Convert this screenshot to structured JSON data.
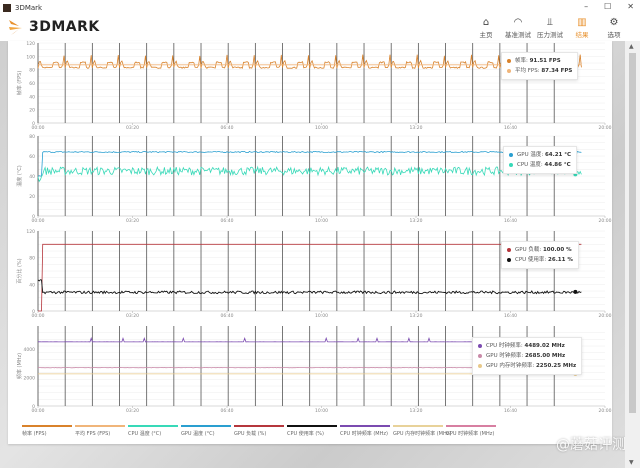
{
  "window": {
    "title": "3DMark",
    "minimize": "–",
    "maximize": "☐",
    "close": "✕"
  },
  "header": {
    "logo": "3DMARK",
    "nav": [
      {
        "label": "主页",
        "icon": "home-icon",
        "glyph": "⌂"
      },
      {
        "label": "基准测试",
        "icon": "gauge-icon",
        "glyph": "◠"
      },
      {
        "label": "压力测试",
        "icon": "stress-chart-icon",
        "glyph": "⫫"
      },
      {
        "label": "结果",
        "icon": "results-bar-icon",
        "glyph": "▥",
        "active": true
      },
      {
        "label": "选项",
        "icon": "gear-icon",
        "glyph": "⚙"
      }
    ]
  },
  "tooltips": {
    "fps": [
      {
        "label": "帧率:",
        "value": "91.51 FPS",
        "color": "#d9822b"
      },
      {
        "label": "平均 FPS:",
        "value": "87.34 FPS",
        "color": "#f0b57a"
      }
    ],
    "temp": [
      {
        "label": "GPU 温度:",
        "value": "64.21 °C",
        "color": "#2a9fd0"
      },
      {
        "label": "CPU 温度:",
        "value": "44.86 °C",
        "color": "#38d9b8"
      }
    ],
    "load": [
      {
        "label": "GPU 负载:",
        "value": "100.00 %",
        "color": "#b5363c"
      },
      {
        "label": "CPU 使用率:",
        "value": "26.11 %",
        "color": "#111111"
      }
    ],
    "clock": [
      {
        "label": "CPU 时钟频率:",
        "value": "4489.02 MHz",
        "color": "#7b4bb0"
      },
      {
        "label": "GPU 时钟频率:",
        "value": "2685.00 MHz",
        "color": "#c98aa8"
      },
      {
        "label": "GPU 内存时钟频率:",
        "value": "2250.25 MHz",
        "color": "#e8c98a"
      }
    ]
  },
  "legend": [
    {
      "label": "帧率 (FPS)",
      "color": "#d9822b"
    },
    {
      "label": "平均 FPS (FPS)",
      "color": "#f0b57a"
    },
    {
      "label": "CPU 温度 (°C)",
      "color": "#38d9b8"
    },
    {
      "label": "GPU 温度 (°C)",
      "color": "#2a9fd0"
    },
    {
      "label": "GPU 负载 (%)",
      "color": "#b5363c"
    },
    {
      "label": "CPU 使用率 (%)",
      "color": "#111111"
    },
    {
      "label": "CPU 时钟频率 (MHz)",
      "color": "#7b4bb0"
    },
    {
      "label": "GPU 内存时钟频率 (MHz)",
      "color": "#e8d29a"
    },
    {
      "label": "GPU 时钟频率 (MHz)",
      "color": "#d77fa1"
    }
  ],
  "watermark": "@蘑菇评测",
  "chart_data": [
    {
      "type": "line",
      "ylabel": "帧率 (FPS)",
      "ylim": [
        0,
        120
      ],
      "yticks": [
        0,
        20,
        40,
        60,
        80,
        100,
        120
      ],
      "xticks": [
        "00:00",
        "03:20",
        "06:40",
        "10:00",
        "13:20",
        "16:40",
        "20:00"
      ],
      "xlim_sec": [
        0,
        1200
      ],
      "end_sec": 1150,
      "series": [
        {
          "name": "帧率",
          "color": "#d9822b",
          "base": 82,
          "pattern": "loop-spikes",
          "peak": 115,
          "values_hint": [
            80,
            92,
            115,
            82,
            80
          ]
        },
        {
          "name": "平均 FPS",
          "color": "#f0b57a",
          "values": [
            87.34
          ]
        }
      ]
    },
    {
      "type": "line",
      "ylabel": "温度 (°C)",
      "ylim": [
        0,
        80
      ],
      "yticks": [
        0,
        20,
        40,
        60,
        80
      ],
      "xticks": [
        "00:00",
        "03:20",
        "06:40",
        "10:00",
        "13:20",
        "16:40",
        "20:00"
      ],
      "end_sec": 1150,
      "series": [
        {
          "name": "GPU 温度",
          "color": "#2a9fd0",
          "start": 40,
          "steady": 64,
          "noise": 0.6
        },
        {
          "name": "CPU 温度",
          "color": "#38d9b8",
          "start": 38,
          "steady": 45,
          "noise": 4
        }
      ]
    },
    {
      "type": "line",
      "ylabel": "百分比 (%)",
      "ylim": [
        0,
        120
      ],
      "yticks": [
        0,
        40,
        80,
        120
      ],
      "xticks": [
        "00:00",
        "03:20",
        "06:40",
        "10:00",
        "13:20",
        "16:40",
        "20:00"
      ],
      "end_sec": 1150,
      "series": [
        {
          "name": "GPU 负载",
          "color": "#b5363c",
          "start": 0,
          "steady": 100,
          "noise": 0
        },
        {
          "name": "CPU 使用率",
          "color": "#111111",
          "start": 45,
          "steady": 28,
          "noise": 2
        }
      ]
    },
    {
      "type": "line",
      "ylabel": "频率 (MHz)",
      "ylim": [
        0,
        5600
      ],
      "yticks": [
        0,
        2000,
        4000
      ],
      "xticks": [
        "00:00",
        "03:20",
        "06:40",
        "10:00",
        "13:20",
        "16:40",
        "20:00"
      ],
      "end_sec": 1150,
      "series": [
        {
          "name": "CPU 时钟频率",
          "color": "#7b4bb0",
          "steady": 4489,
          "noise": 5
        },
        {
          "name": "GPU 时钟频率",
          "color": "#c98aa8",
          "steady": 2685,
          "noise": 10
        },
        {
          "name": "GPU 内存时钟频率",
          "color": "#e8c98a",
          "steady": 2250,
          "noise": 0
        }
      ]
    }
  ]
}
